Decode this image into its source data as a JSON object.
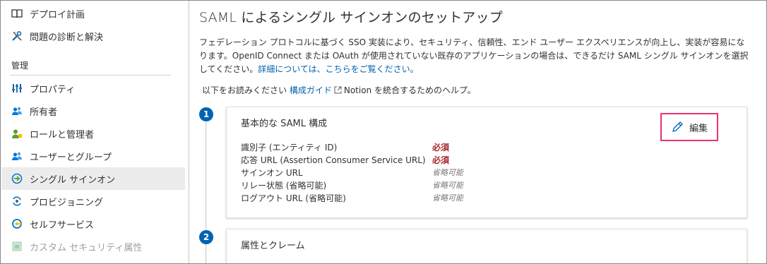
{
  "sidebar": {
    "items_top": [
      {
        "label": "デプロイ計画",
        "icon": "book-icon"
      },
      {
        "label": "問題の診断と解決",
        "icon": "tools-icon"
      }
    ],
    "section_label": "管理",
    "items": [
      {
        "label": "プロパティ",
        "icon": "properties-icon"
      },
      {
        "label": "所有者",
        "icon": "owners-icon"
      },
      {
        "label": "ロールと管理者",
        "icon": "roles-admins-icon"
      },
      {
        "label": "ユーザーとグループ",
        "icon": "users-groups-icon"
      },
      {
        "label": "シングル サインオン",
        "icon": "single-sign-on-icon",
        "active": true
      },
      {
        "label": "プロビジョニング",
        "icon": "provisioning-icon"
      },
      {
        "label": "セルフサービス",
        "icon": "self-service-icon"
      },
      {
        "label": "カスタム セキュリティ属性",
        "icon": "custom-security-attributes-icon",
        "disabled": true
      }
    ]
  },
  "main": {
    "title": "SAML によるシングル サインオンのセットアップ",
    "intro_line1": "フェデレーション プロトコルに基づく SSO 実装により、セキュリティ、信頼性、エンド ユーザー エクスペリエンスが向上し、実装が容易にな",
    "intro_line2": "ります。OpenID Connect または OAuth が使用されていない既存のアプリケーションの場合は、できるだけ SAML シングル サインオンを選択",
    "intro_line3": "してください。",
    "intro_link": "詳細については、こちらをご覧ください。",
    "guide_prefix": "以下をお読みください",
    "guide_link": "構成ガイド",
    "guide_suffix": "Notion を統合するためのヘルプ。"
  },
  "steps": [
    {
      "number": "1",
      "title": "基本的な SAML 構成",
      "edit_label": "編集",
      "fields": [
        {
          "label": "識別子 (エンティティ ID)",
          "value": "必須",
          "status": "required"
        },
        {
          "label": "応答 URL (Assertion Consumer Service URL)",
          "value": "必須",
          "status": "required"
        },
        {
          "label": "サインオン URL",
          "value": "省略可能",
          "status": "optional"
        },
        {
          "label": "リレー状態 (省略可能)",
          "value": "省略可能",
          "status": "optional"
        },
        {
          "label": "ログアウト URL (省略可能)",
          "value": "省略可能",
          "status": "optional"
        }
      ]
    },
    {
      "number": "2",
      "title": "属性とクレーム"
    }
  ],
  "colors": {
    "accent": "#0063b1",
    "required": "#a4262c",
    "highlight_border": "#e8346f",
    "active_bg": "#ececec"
  }
}
